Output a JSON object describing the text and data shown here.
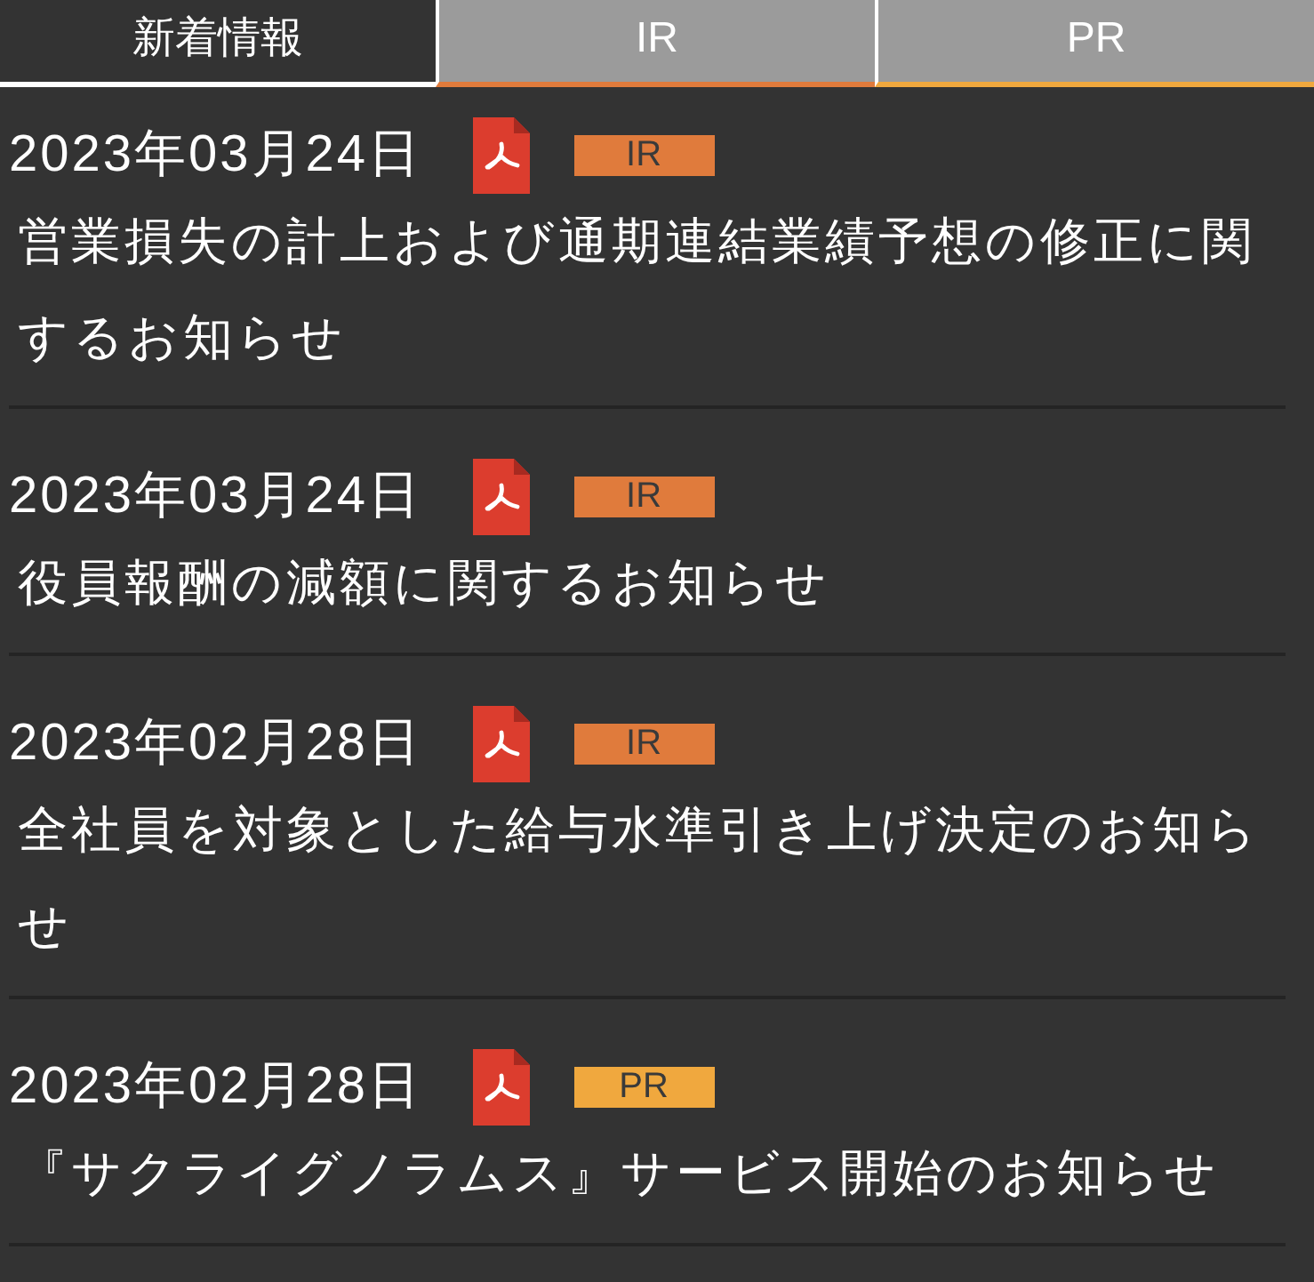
{
  "tabs": [
    {
      "label": "新着情報",
      "selected": true,
      "color": "#ffffff"
    },
    {
      "label": "IR",
      "selected": false,
      "color": "#e07b3c"
    },
    {
      "label": "PR",
      "selected": false,
      "color": "#f0a83e"
    }
  ],
  "items": [
    {
      "date": "2023年03月24日",
      "tag": {
        "label": "IR",
        "color": "#e07b3c"
      },
      "title": "営業損失の計上および通期連結業績予想の修正に関するお知らせ"
    },
    {
      "date": "2023年03月24日",
      "tag": {
        "label": "IR",
        "color": "#e07b3c"
      },
      "title": "役員報酬の減額に関するお知らせ"
    },
    {
      "date": "2023年02月28日",
      "tag": {
        "label": "IR",
        "color": "#e07b3c"
      },
      "title": "全社員を対象とした給与水準引き上げ決定のお知らせ"
    },
    {
      "date": "2023年02月28日",
      "tag": {
        "label": "PR",
        "color": "#f0a83e"
      },
      "title": "『サクライグノラムス』サービス開始のお知らせ"
    }
  ]
}
